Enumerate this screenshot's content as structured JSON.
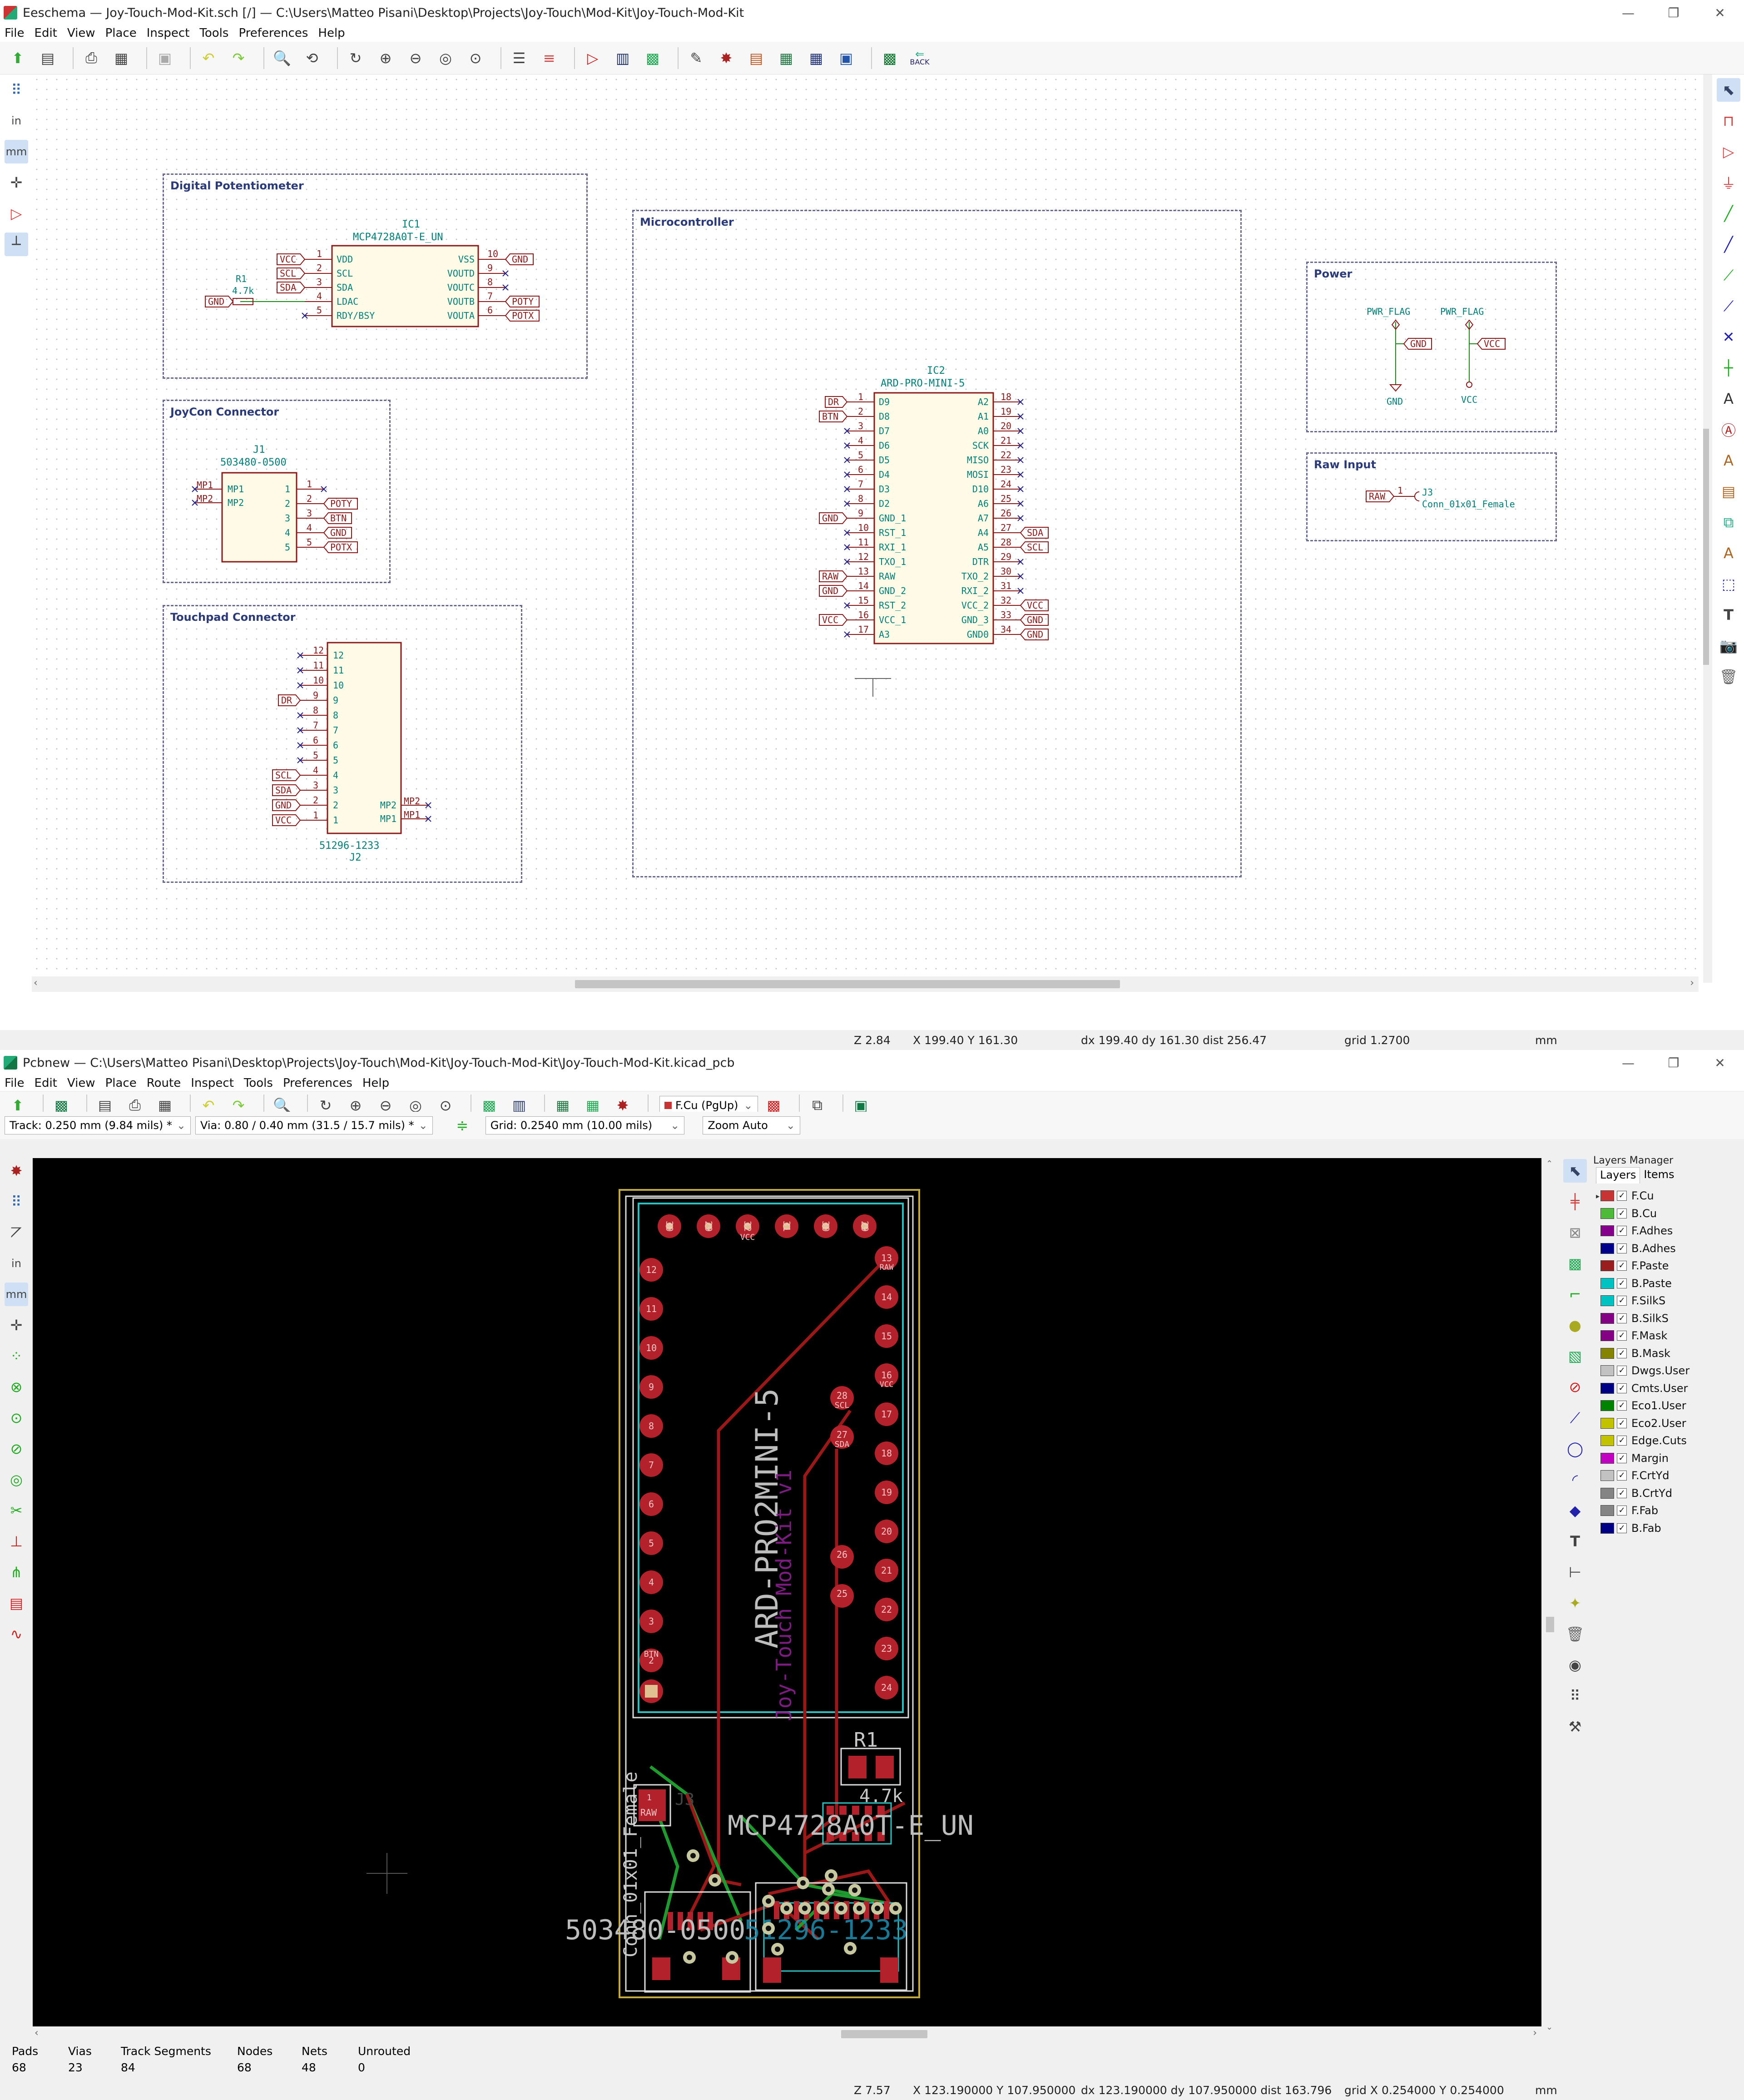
{
  "eeschema": {
    "title": "Eeschema — Joy-Touch-Mod-Kit.sch [/] — C:\\Users\\Matteo Pisani\\Desktop\\Projects\\Joy-Touch\\Mod-Kit\\Joy-Touch-Mod-Kit",
    "menu": [
      "File",
      "Edit",
      "View",
      "Place",
      "Inspect",
      "Tools",
      "Preferences",
      "Help"
    ],
    "back_label": "BACK",
    "left_tools": [
      "in",
      "mm"
    ],
    "sheets": [
      {
        "id": "digipot",
        "label": "Digital Potentiometer"
      },
      {
        "id": "joycon",
        "label": "JoyCon Connector"
      },
      {
        "id": "touchpad",
        "label": "Touchpad Connector"
      },
      {
        "id": "micro",
        "label": "Microcontroller"
      },
      {
        "id": "power",
        "label": "Power"
      },
      {
        "id": "raw",
        "label": "Raw Input"
      }
    ],
    "digipot": {
      "ref": "IC1",
      "value": "MCP4728A0T-E_UN",
      "r_ref": "R1",
      "r_val": "4.7k",
      "left_pins": [
        {
          "n": "1",
          "name": "VDD",
          "net": "VCC"
        },
        {
          "n": "2",
          "name": "SCL",
          "net": "SCL"
        },
        {
          "n": "3",
          "name": "SDA",
          "net": "SDA"
        },
        {
          "n": "4",
          "name": "LDAC",
          "net": ""
        },
        {
          "n": "5",
          "name": "RDY/BSY",
          "net": ""
        }
      ],
      "right_pins": [
        {
          "n": "10",
          "name": "VSS",
          "net": "GND"
        },
        {
          "n": "9",
          "name": "VOUTD",
          "net": ""
        },
        {
          "n": "8",
          "name": "VOUTC",
          "net": ""
        },
        {
          "n": "7",
          "name": "VOUTB",
          "net": "POTY"
        },
        {
          "n": "6",
          "name": "VOUTA",
          "net": "POTX"
        }
      ],
      "gnd_label": "GND"
    },
    "joycon": {
      "ref": "J1",
      "value": "503480-0500",
      "mp": [
        "MP1",
        "MP2"
      ],
      "pins": [
        {
          "n": "1",
          "net": ""
        },
        {
          "n": "2",
          "net": "POTY"
        },
        {
          "n": "3",
          "net": "BTN"
        },
        {
          "n": "4",
          "net": "GND"
        },
        {
          "n": "5",
          "net": "POTX"
        }
      ]
    },
    "touchpad": {
      "ref": "J2",
      "value": "51296-1233",
      "pins": [
        {
          "n": "12",
          "net": ""
        },
        {
          "n": "11",
          "net": ""
        },
        {
          "n": "10",
          "net": ""
        },
        {
          "n": "9",
          "net": "DR"
        },
        {
          "n": "8",
          "net": ""
        },
        {
          "n": "7",
          "net": ""
        },
        {
          "n": "6",
          "net": ""
        },
        {
          "n": "5",
          "net": ""
        },
        {
          "n": "4",
          "net": "SCL"
        },
        {
          "n": "3",
          "net": "SDA"
        },
        {
          "n": "2",
          "net": "GND"
        },
        {
          "n": "1",
          "net": "VCC"
        }
      ],
      "mp": [
        "MP2",
        "MP1"
      ]
    },
    "micro": {
      "ref": "IC2",
      "value": "ARD-PRO-MINI-5",
      "left_pins": [
        {
          "n": "1",
          "name": "D9",
          "net": "DR"
        },
        {
          "n": "2",
          "name": "D8",
          "net": "BTN"
        },
        {
          "n": "3",
          "name": "D7",
          "net": ""
        },
        {
          "n": "4",
          "name": "D6",
          "net": ""
        },
        {
          "n": "5",
          "name": "D5",
          "net": ""
        },
        {
          "n": "6",
          "name": "D4",
          "net": ""
        },
        {
          "n": "7",
          "name": "D3",
          "net": ""
        },
        {
          "n": "8",
          "name": "D2",
          "net": ""
        },
        {
          "n": "9",
          "name": "GND_1",
          "net": "GND"
        },
        {
          "n": "10",
          "name": "RST_1",
          "net": ""
        },
        {
          "n": "11",
          "name": "RXI_1",
          "net": ""
        },
        {
          "n": "12",
          "name": "TXO_1",
          "net": ""
        },
        {
          "n": "13",
          "name": "RAW",
          "net": "RAW"
        },
        {
          "n": "14",
          "name": "GND_2",
          "net": "GND"
        },
        {
          "n": "15",
          "name": "RST_2",
          "net": ""
        },
        {
          "n": "16",
          "name": "VCC_1",
          "net": "VCC"
        },
        {
          "n": "17",
          "name": "A3",
          "net": ""
        }
      ],
      "right_pins": [
        {
          "n": "18",
          "name": "A2",
          "net": ""
        },
        {
          "n": "19",
          "name": "A1",
          "net": ""
        },
        {
          "n": "20",
          "name": "A0",
          "net": ""
        },
        {
          "n": "21",
          "name": "SCK",
          "net": ""
        },
        {
          "n": "22",
          "name": "MISO",
          "net": ""
        },
        {
          "n": "23",
          "name": "MOSI",
          "net": ""
        },
        {
          "n": "24",
          "name": "D10",
          "net": ""
        },
        {
          "n": "25",
          "name": "A6",
          "net": ""
        },
        {
          "n": "26",
          "name": "A7",
          "net": ""
        },
        {
          "n": "27",
          "name": "A4",
          "net": "SDA"
        },
        {
          "n": "28",
          "name": "A5",
          "net": "SCL"
        },
        {
          "n": "29",
          "name": "DTR",
          "net": ""
        },
        {
          "n": "30",
          "name": "TXO_2",
          "net": ""
        },
        {
          "n": "31",
          "name": "RXI_2",
          "net": ""
        },
        {
          "n": "32",
          "name": "VCC_2",
          "net": "VCC"
        },
        {
          "n": "33",
          "name": "GND_3",
          "net": "GND"
        },
        {
          "n": "34",
          "name": "GND0",
          "net": "GND"
        }
      ]
    },
    "power": {
      "flag1": "PWR_FLAG",
      "flag2": "PWR_FLAG",
      "gnd": "GND",
      "vcc": "VCC"
    },
    "raw": {
      "ref": "J3",
      "value": "Conn_01x01_Female",
      "net": "RAW",
      "pin": "1"
    },
    "status": {
      "zoom": "Z 2.84",
      "xy": "X 199.40  Y 161.30",
      "delta": "dx 199.40  dy 161.30  dist 256.47",
      "grid": "grid 1.2700",
      "units": "mm"
    }
  },
  "pcbnew": {
    "title": "Pcbnew — C:\\Users\\Matteo Pisani\\Desktop\\Projects\\Joy-Touch\\Mod-Kit\\Joy-Touch-Mod-Kit\\Joy-Touch-Mod-Kit.kicad_pcb",
    "menu": [
      "File",
      "Edit",
      "View",
      "Place",
      "Route",
      "Inspect",
      "Tools",
      "Preferences",
      "Help"
    ],
    "layer_select": "F.Cu (PgUp)",
    "track": "Track: 0.250 mm (9.84 mils) *",
    "via": "Via: 0.80 / 0.40 mm (31.5 / 15.7 mils) *",
    "grid": "Grid: 0.2540 mm (10.00 mils)",
    "zoom": "Zoom Auto",
    "left_tools": [
      "in",
      "mm"
    ],
    "layers_manager": {
      "title": "Layers Manager",
      "tabs": [
        "Layers",
        "Items"
      ]
    },
    "layers": [
      {
        "name": "F.Cu",
        "color": "#c83434"
      },
      {
        "name": "B.Cu",
        "color": "#4dba3a"
      },
      {
        "name": "F.Adhes",
        "color": "#84008a"
      },
      {
        "name": "B.Adhes",
        "color": "#00008a"
      },
      {
        "name": "F.Paste",
        "color": "#9b1e1e"
      },
      {
        "name": "B.Paste",
        "color": "#00c2c2"
      },
      {
        "name": "F.SilkS",
        "color": "#00c2c2"
      },
      {
        "name": "B.SilkS",
        "color": "#840084"
      },
      {
        "name": "F.Mask",
        "color": "#840084"
      },
      {
        "name": "B.Mask",
        "color": "#848400"
      },
      {
        "name": "Dwgs.User",
        "color": "#c2c2c2"
      },
      {
        "name": "Cmts.User",
        "color": "#000084"
      },
      {
        "name": "Eco1.User",
        "color": "#008400"
      },
      {
        "name": "Eco2.User",
        "color": "#c2c200"
      },
      {
        "name": "Edge.Cuts",
        "color": "#c2c200"
      },
      {
        "name": "Margin",
        "color": "#c200c2"
      },
      {
        "name": "F.CrtYd",
        "color": "#c2c2c2"
      },
      {
        "name": "B.CrtYd",
        "color": "#848484"
      },
      {
        "name": "F.Fab",
        "color": "#848484"
      },
      {
        "name": "B.Fab",
        "color": "#000084"
      }
    ],
    "board": {
      "ic2_value": "ARD-PRO2MINI-5",
      "silk_text": "Joy-Touch Mod-Kit v1",
      "fab_text": "MCP4728A0T-E_UN",
      "j1_value": "503480-0500",
      "j2_value": "51296-1233",
      "j3_value": "Conn_01x01_Female",
      "r1_ref": "R1",
      "r1_val": "4.7k",
      "j3_ref": "J3",
      "top_pads": [
        "30",
        "29",
        "32",
        "31",
        "30",
        "29"
      ],
      "top_pads_nets": [
        "",
        "",
        "VCC",
        "",
        "",
        ""
      ],
      "left_pads": [
        "12",
        "11",
        "10",
        "9",
        "8",
        "7",
        "6",
        "5",
        "4",
        "3",
        "2"
      ],
      "right_pads": [
        "13",
        "14",
        "15",
        "16",
        "17",
        "18",
        "19",
        "20",
        "21",
        "22",
        "23",
        "24"
      ],
      "right_pads_nets": [
        "RAW",
        "",
        "",
        "VCC",
        "",
        "",
        "",
        "",
        "",
        "",
        "",
        ""
      ],
      "inner_pads": [
        {
          "n": "28",
          "net": "SCL"
        },
        {
          "n": "27",
          "net": "SDA"
        },
        {
          "n": "26",
          "net": ""
        },
        {
          "n": "25",
          "net": ""
        }
      ],
      "btn_label": "BTN",
      "raw_label": "RAW",
      "pad1": "1"
    },
    "stats": {
      "headers": [
        "Pads",
        "Vias",
        "Track Segments",
        "Nodes",
        "Nets",
        "Unrouted"
      ],
      "values": [
        "68",
        "23",
        "84",
        "68",
        "48",
        "0"
      ]
    },
    "status": {
      "zoom": "Z 7.57",
      "xy": "X 123.190000  Y 107.950000",
      "delta": "dx 123.190000  dy 107.950000  dist 163.796",
      "grid": "grid X 0.254000  Y 0.254000",
      "units": "mm"
    }
  }
}
